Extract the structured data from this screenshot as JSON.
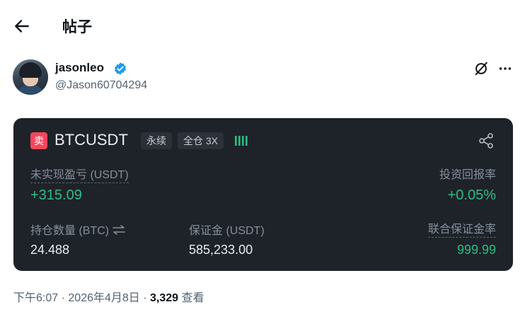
{
  "header": {
    "title": "帖子"
  },
  "author": {
    "display_name": "jasonleo",
    "handle": "@Jason60704294",
    "verified": true
  },
  "card": {
    "side": "卖",
    "symbol": "BTCUSDT",
    "type_tag": "永续",
    "margin_tag": "全仓 3X",
    "unrealized_pnl_label": "未实现盈亏 (USDT)",
    "unrealized_pnl_value": "+315.09",
    "roi_label": "投资回报率",
    "roi_value": "+0.05%",
    "size_label": "持仓数量 (BTC)",
    "size_value": "24.488",
    "margin_label": "保证金 (USDT)",
    "margin_value": "585,233.00",
    "margin_ratio_label": "联合保证金率",
    "margin_ratio_value": "999.99",
    "colors": {
      "background": "#1e2329",
      "positive": "#2ebd85",
      "sell": "#f6465d"
    }
  },
  "meta": {
    "time": "下午6:07",
    "date": "2026年4月8日",
    "separator": "·",
    "views_count": "3,329",
    "views_label": "查看"
  },
  "icons": [
    "back-arrow-icon",
    "verified-badge-icon",
    "grok-icon",
    "more-icon",
    "share-icon",
    "swap-arrows-icon",
    "signal-bars-icon"
  ]
}
